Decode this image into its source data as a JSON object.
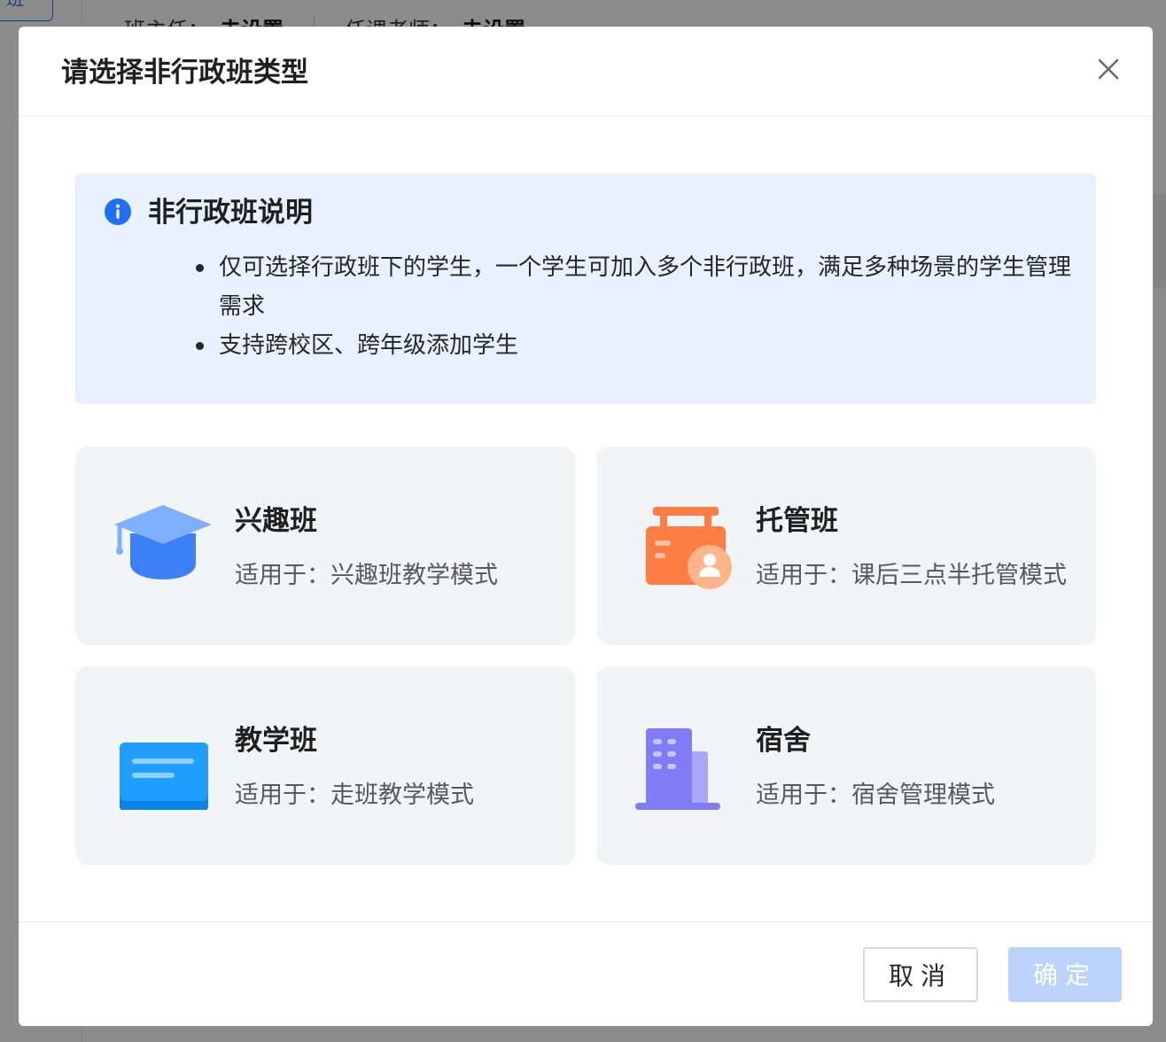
{
  "background": {
    "left_button_label": "班",
    "header_fields": [
      {
        "label": "班主任：",
        "value": "未设置"
      },
      {
        "label": "任课老师：",
        "value": "未设置"
      }
    ]
  },
  "modal": {
    "title": "请选择非行政班类型",
    "close_icon": "close-icon",
    "notice": {
      "icon": "info-icon",
      "title": "非行政班说明",
      "items": [
        "仅可选择行政班下的学生，一个学生可加入多个非行政班，满足多种场景的学生管理需求",
        "支持跨校区、跨年级添加学生"
      ]
    },
    "options": [
      {
        "title": "兴趣班",
        "desc": "适用于：兴趣班教学模式",
        "icon": "graduation-cap-icon"
      },
      {
        "title": "托管班",
        "desc": "适用于：课后三点半托管模式",
        "icon": "custody-box-icon"
      },
      {
        "title": "教学班",
        "desc": "适用于：走班教学模式",
        "icon": "board-icon"
      },
      {
        "title": "宿舍",
        "desc": "适用于：宿舍管理模式",
        "icon": "building-icon"
      }
    ],
    "footer": {
      "cancel_label": "取消",
      "confirm_label": "确定"
    }
  },
  "colors": {
    "primary": "#2f6fe0",
    "notice_bg": "#e8f1ff",
    "card_bg": "#f3f4f6",
    "confirm_disabled": "#bcd4fb",
    "icon_blue": "#3d7ff5",
    "icon_orange": "#ff7d45",
    "icon_sky": "#1f9eff",
    "icon_purple": "#7f7cf5"
  }
}
